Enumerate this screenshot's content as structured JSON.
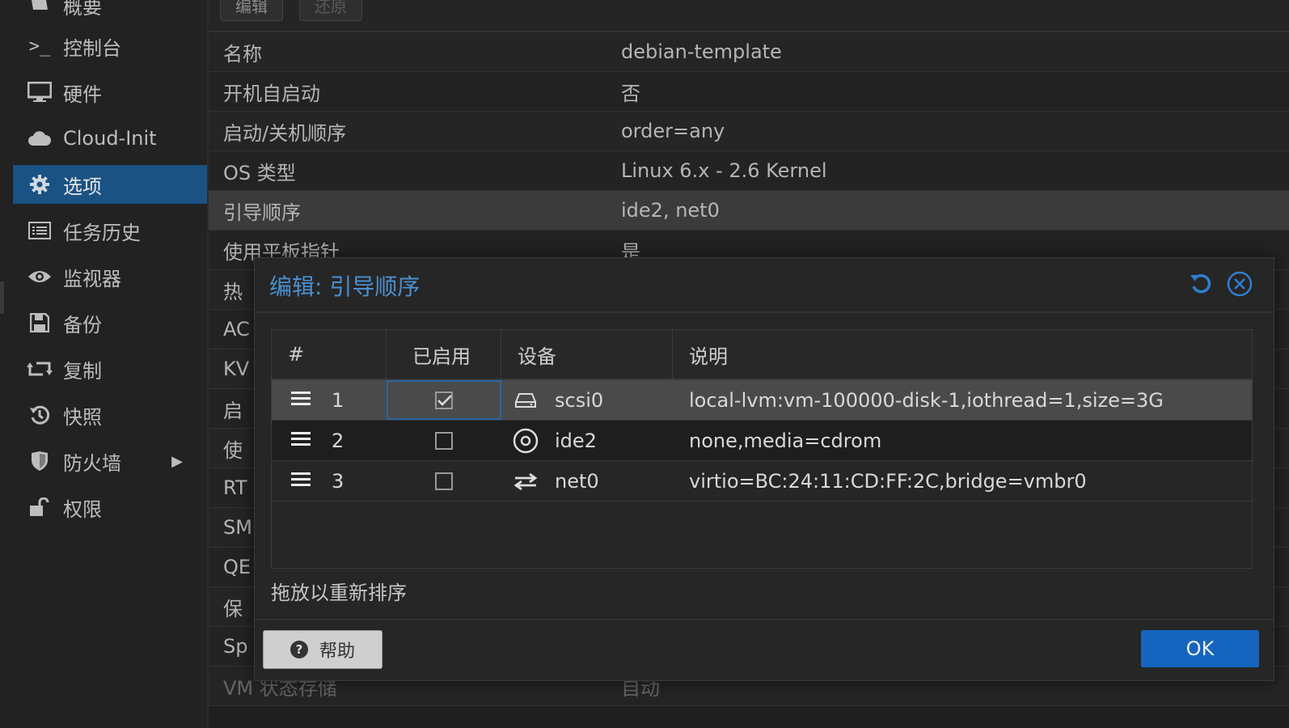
{
  "sidebar": {
    "items": [
      {
        "label": "概要",
        "icon": "summary-icon"
      },
      {
        "label": "控制台",
        "icon": "terminal-icon"
      },
      {
        "label": "硬件",
        "icon": "monitor-icon"
      },
      {
        "label": "Cloud-Init",
        "icon": "cloud-icon"
      },
      {
        "label": "选项",
        "icon": "gear-icon"
      },
      {
        "label": "任务历史",
        "icon": "list-icon"
      },
      {
        "label": "监视器",
        "icon": "eye-icon"
      },
      {
        "label": "备份",
        "icon": "floppy-icon"
      },
      {
        "label": "复制",
        "icon": "retweet-icon"
      },
      {
        "label": "快照",
        "icon": "history-icon"
      },
      {
        "label": "防火墙",
        "icon": "shield-icon"
      },
      {
        "label": "权限",
        "icon": "unlock-icon"
      }
    ]
  },
  "toolbar": {
    "edit_label": "编辑",
    "revert_label": "还原"
  },
  "options": {
    "rows": [
      {
        "key": "名称",
        "value": "debian-template"
      },
      {
        "key": "开机自启动",
        "value": "否"
      },
      {
        "key": "启动/关机顺序",
        "value": "order=any"
      },
      {
        "key": "OS 类型",
        "value": "Linux 6.x - 2.6 Kernel"
      },
      {
        "key": "引导顺序",
        "value": "ide2, net0"
      },
      {
        "key": "使用平板指针",
        "value": "是"
      }
    ],
    "partial_keys": [
      "热",
      "AC",
      "KV",
      "启",
      "使",
      "RT",
      "SM",
      "QE",
      "保",
      "Sp"
    ],
    "last_row": {
      "key": "VM 状态存储",
      "value": "自动"
    }
  },
  "dialog": {
    "title": "编辑: 引导顺序",
    "columns": [
      "#",
      "已启用",
      "设备",
      "说明"
    ],
    "rows": [
      {
        "num": "1",
        "enabled": true,
        "device": "scsi0",
        "icon": "hdd-icon",
        "desc": "local-lvm:vm-100000-disk-1,iothread=1,size=3G"
      },
      {
        "num": "2",
        "enabled": false,
        "device": "ide2",
        "icon": "cdrom-icon",
        "desc": "none,media=cdrom"
      },
      {
        "num": "3",
        "enabled": false,
        "device": "net0",
        "icon": "network-exchange-icon",
        "desc": "virtio=BC:24:11:CD:FF:2C,bridge=vmbr0"
      }
    ],
    "hint": "拖放以重新排序",
    "help_label": "帮助",
    "ok_label": "OK"
  },
  "colors": {
    "accent": "#1565c0",
    "active_nav": "#1a5284",
    "title": "#4a90d0"
  }
}
